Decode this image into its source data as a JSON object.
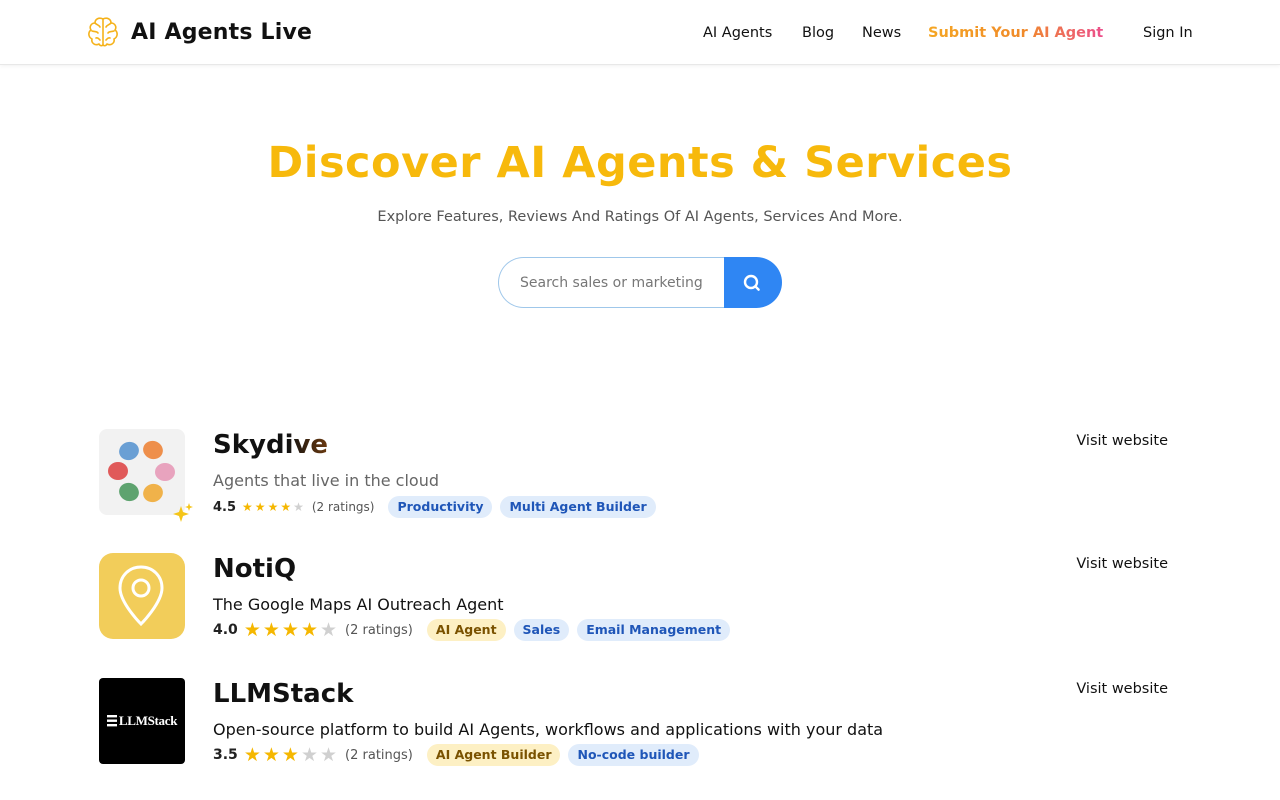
{
  "header": {
    "brand": "AI Agents Live",
    "nav": {
      "agents": "AI Agents",
      "blog": "Blog",
      "news": "News",
      "submit": "Submit Your AI Agent",
      "signin": "Sign In"
    }
  },
  "hero": {
    "title": "Discover AI Agents & Services",
    "subtitle": "Explore Features, Reviews And Ratings Of AI Agents, Services And More.",
    "search_placeholder": "Search sales or marketing"
  },
  "agents": [
    {
      "name": "Skydive",
      "tagline": "Agents that live in the cloud",
      "rating": "4.5",
      "stars": 4.5,
      "ratings_count": "(2 ratings)",
      "tags": [
        "Productivity",
        "Multi Agent Builder"
      ],
      "visit": "Visit website"
    },
    {
      "name": "NotiQ",
      "tagline": "The Google Maps AI Outreach Agent",
      "rating": "4.0",
      "stars": 4,
      "ratings_count": "(2 ratings)",
      "tags": [
        "AI Agent",
        "Sales",
        "Email Management"
      ],
      "visit": "Visit website"
    },
    {
      "name": "LLMStack",
      "tagline": "Open-source platform to build AI Agents, workflows and applications with your data",
      "rating": "3.5",
      "stars": 3.5,
      "ratings_count": "(2 ratings)",
      "tags": [
        "AI Agent Builder",
        "No-code builder"
      ],
      "visit": "Visit website",
      "logo_text": "LLMStack"
    }
  ],
  "colors": {
    "accent_yellow": "#f7b90c",
    "search_blue": "#2f86f3",
    "notiq_yellow": "#f2cd5a"
  }
}
